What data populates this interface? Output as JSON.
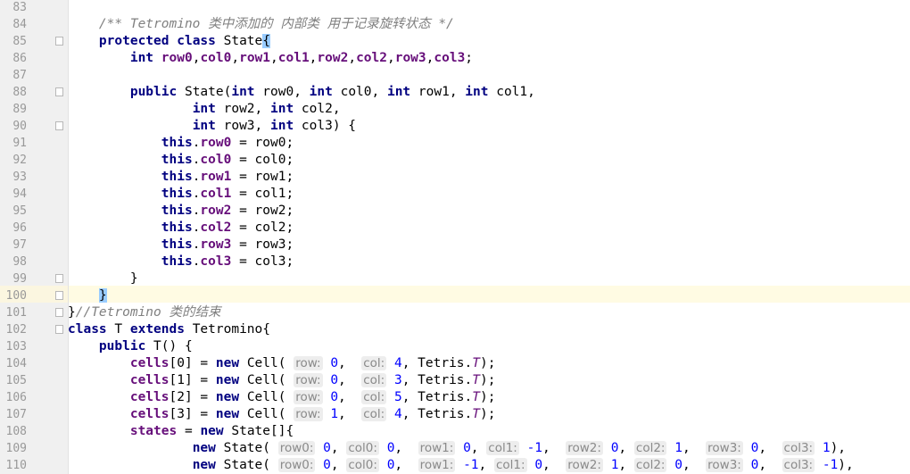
{
  "editor": {
    "line_numbers": [
      "83",
      "84",
      "85",
      "86",
      "87",
      "88",
      "89",
      "90",
      "91",
      "92",
      "93",
      "94",
      "95",
      "96",
      "97",
      "98",
      "99",
      "100",
      "101",
      "102",
      "103",
      "104",
      "105",
      "106",
      "107",
      "108",
      "109",
      "110"
    ],
    "comment_84": "/** Tetromino 类中添加的 内部类 用于记录旋转状态 */",
    "comment_101": "//Tetromino 类的结束",
    "kw": {
      "protected": "protected",
      "class": "class",
      "int": "int",
      "public": "public",
      "this": "this",
      "extends": "extends",
      "new": "new"
    },
    "names": {
      "state": "State",
      "t": "T",
      "tetromino": "Tetromino",
      "cell": "Cell",
      "tetris": "Tetris",
      "cells": "cells",
      "states": "states"
    },
    "fields": [
      "row0",
      "col0",
      "row1",
      "col1",
      "row2",
      "col2",
      "row3",
      "col3"
    ],
    "hints": {
      "row": "row:",
      "col": "col:",
      "row0": "row0:",
      "col0": "col0:",
      "row1": "row1:",
      "col1": "col1:",
      "row2": "row2:",
      "col2": "col2:",
      "row3": "row3:",
      "col3": "col3:"
    },
    "cell_rows": [
      {
        "index": "0",
        "row": "0",
        "col": "4"
      },
      {
        "index": "1",
        "row": "0",
        "col": "3"
      },
      {
        "index": "2",
        "row": "0",
        "col": "5"
      },
      {
        "index": "3",
        "row": "1",
        "col": "4"
      }
    ],
    "state_rows": [
      [
        "0",
        "0",
        "0",
        "-1",
        "0",
        "1",
        "0",
        "1"
      ],
      [
        "0",
        "0",
        "-1",
        "0",
        "1",
        "0",
        "0",
        "-1"
      ]
    ]
  }
}
